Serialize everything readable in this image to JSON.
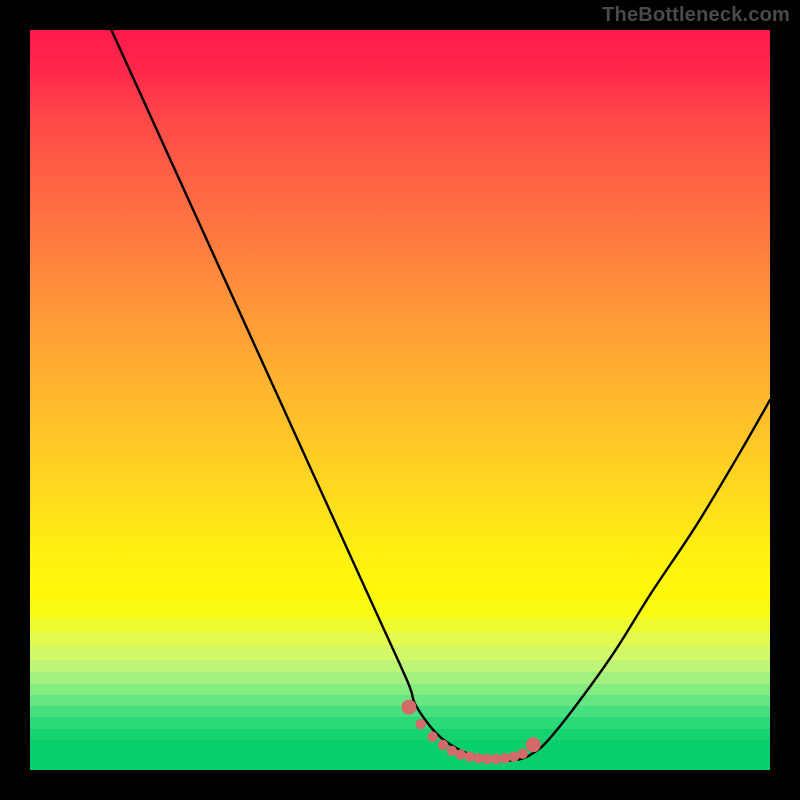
{
  "attribution": "TheBottleneck.com",
  "chart_data": {
    "type": "line",
    "title": "",
    "xlabel": "",
    "ylabel": "",
    "xlim": [
      0,
      100
    ],
    "ylim": [
      0,
      100
    ],
    "background_gradient_stops": [
      {
        "pos": 0,
        "color": "#ff1a4d"
      },
      {
        "pos": 20,
        "color": "#ff6245"
      },
      {
        "pos": 44,
        "color": "#ffa933"
      },
      {
        "pos": 66,
        "color": "#ffe319"
      },
      {
        "pos": 82,
        "color": "#eaf93a"
      },
      {
        "pos": 92,
        "color": "#7cee84"
      },
      {
        "pos": 100,
        "color": "#08d06c"
      }
    ],
    "series": [
      {
        "name": "bottleneck-curve",
        "color": "#000000",
        "x": [
          11,
          16,
          21,
          26,
          31,
          36,
          41,
          46,
          51,
          52,
          54,
          56,
          59,
          63,
          66,
          68,
          70,
          74,
          79,
          84,
          90,
          96,
          100
        ],
        "y_pct": [
          100,
          89,
          78,
          67,
          56,
          45,
          34,
          23,
          12,
          9,
          6,
          4,
          2.3,
          1.4,
          1.4,
          2.3,
          4,
          9,
          16,
          24,
          33,
          43,
          50
        ]
      },
      {
        "name": "sweet-spot-marker",
        "color": "#d46a6a",
        "style": "dots",
        "x": [
          51.2,
          52.8,
          54.4,
          55.8,
          57.0,
          58.2,
          59.4,
          60.6,
          61.8,
          63.0,
          64.2,
          65.4,
          66.6,
          68.0
        ],
        "y_pct": [
          8.5,
          6.2,
          4.5,
          3.4,
          2.6,
          2.1,
          1.8,
          1.6,
          1.5,
          1.5,
          1.6,
          1.8,
          2.2,
          3.4
        ]
      }
    ]
  }
}
